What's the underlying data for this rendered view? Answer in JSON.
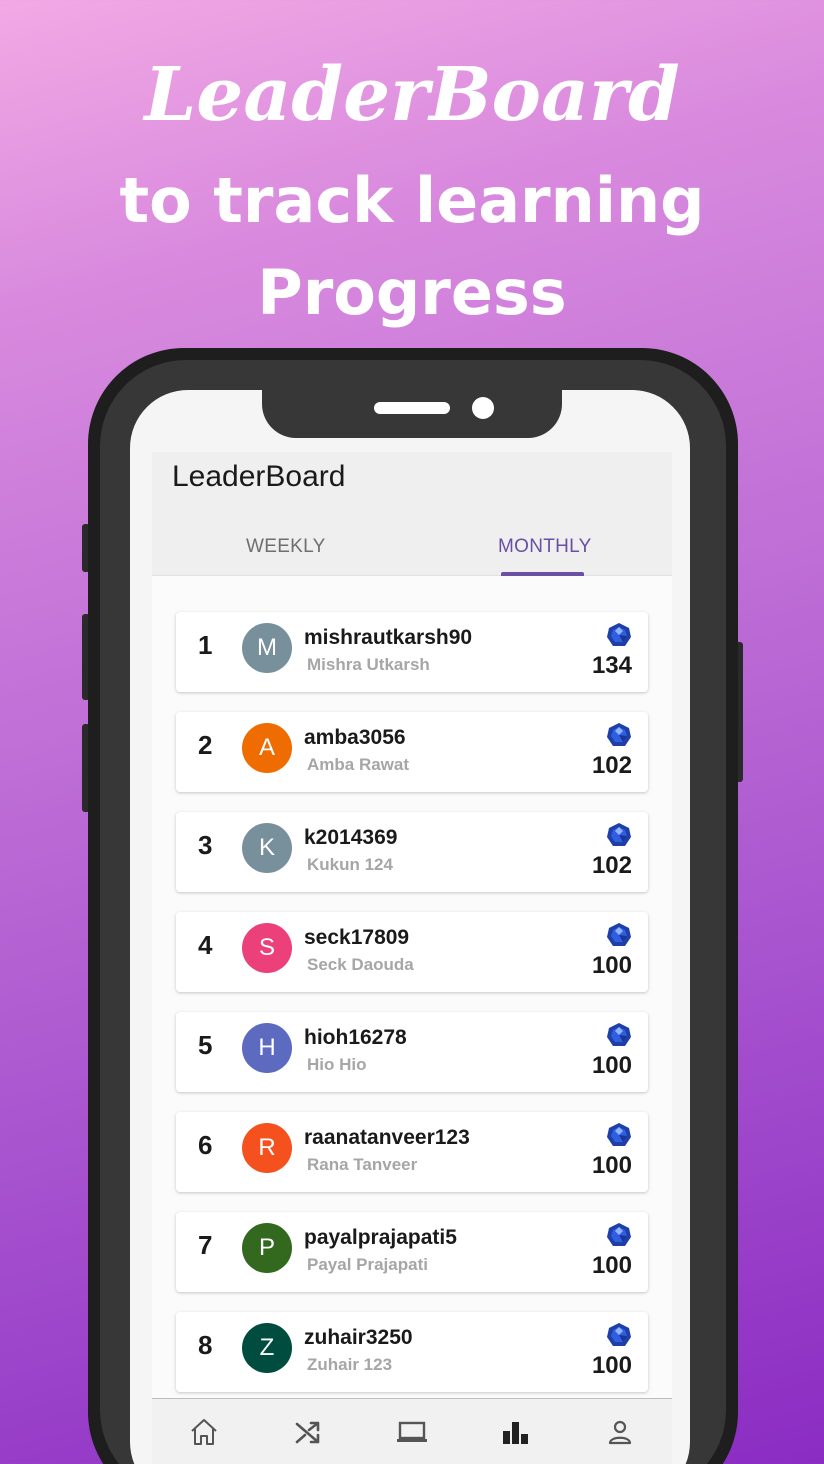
{
  "hero": {
    "title": "LeaderBoard",
    "subtitle_line1": "to track learning",
    "subtitle_line2": "Progress"
  },
  "app": {
    "title": "LeaderBoard",
    "tabs": [
      {
        "label": "WEEKLY",
        "selected": false
      },
      {
        "label": "MONTHLY",
        "selected": true
      }
    ],
    "accent_color": "#6a4fa3",
    "entries": [
      {
        "rank": "1",
        "initial": "M",
        "avatar_color": "#78909c",
        "username": "mishrautkarsh90",
        "name": "Mishra Utkarsh",
        "score": "134"
      },
      {
        "rank": "2",
        "initial": "A",
        "avatar_color": "#ef6c00",
        "username": "amba3056",
        "name": "Amba Rawat",
        "score": "102"
      },
      {
        "rank": "3",
        "initial": "K",
        "avatar_color": "#78909c",
        "username": "k2014369",
        "name": "Kukun 124",
        "score": "102"
      },
      {
        "rank": "4",
        "initial": "S",
        "avatar_color": "#ec407a",
        "username": "seck17809",
        "name": "Seck Daouda",
        "score": "100"
      },
      {
        "rank": "5",
        "initial": "H",
        "avatar_color": "#5c6bc0",
        "username": "hioh16278",
        "name": "Hio Hio",
        "score": "100"
      },
      {
        "rank": "6",
        "initial": "R",
        "avatar_color": "#f4511e",
        "username": "raanatanveer123",
        "name": "Rana Tanveer",
        "score": "100"
      },
      {
        "rank": "7",
        "initial": "P",
        "avatar_color": "#33691e",
        "username": "payalprajapati5",
        "name": "Payal Prajapati",
        "score": "100"
      },
      {
        "rank": "8",
        "initial": "Z",
        "avatar_color": "#004d40",
        "username": "zuhair3250",
        "name": "Zuhair 123",
        "score": "100"
      }
    ],
    "gem_icon": "gem-icon",
    "bottom_nav": [
      {
        "icon": "home-icon",
        "active": false
      },
      {
        "icon": "shuffle-icon",
        "active": false
      },
      {
        "icon": "laptop-icon",
        "active": false
      },
      {
        "icon": "leaderboard-icon",
        "active": true
      },
      {
        "icon": "profile-icon",
        "active": false
      }
    ]
  }
}
